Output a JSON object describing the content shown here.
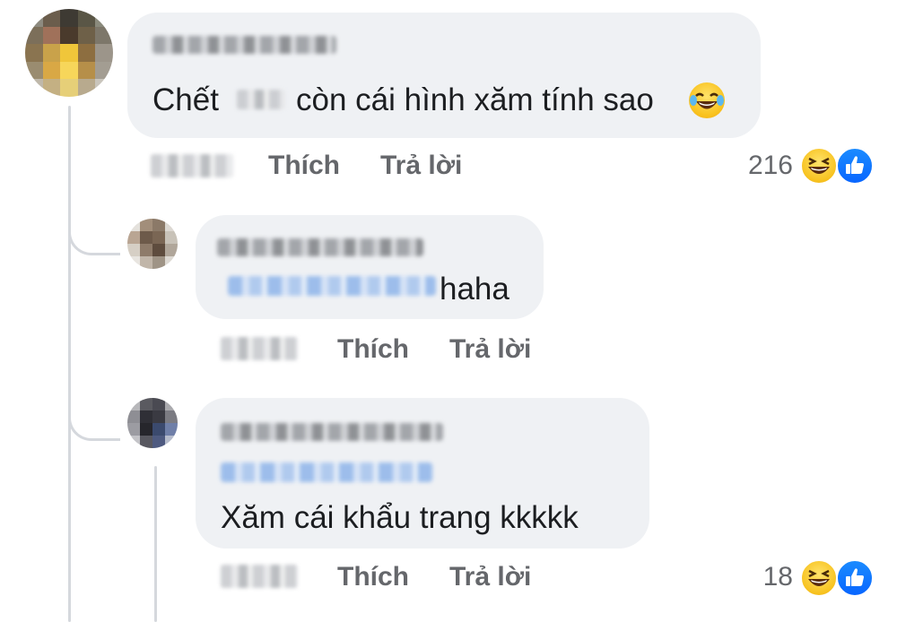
{
  "comments": [
    {
      "text_before": "Chết",
      "text_after": "còn cái hình xăm tính sao",
      "emoji": "face-with-tears-of-joy",
      "actions": {
        "like": "Thích",
        "reply": "Trả lời"
      },
      "reaction_count": "216",
      "reactions": [
        "haha",
        "like"
      ]
    },
    {
      "text": "haha",
      "actions": {
        "like": "Thích",
        "reply": "Trả lời"
      }
    },
    {
      "text": "Xăm cái khẩu trang kkkkk",
      "actions": {
        "like": "Thích",
        "reply": "Trả lời"
      },
      "reaction_count": "18",
      "reactions": [
        "haha",
        "like"
      ]
    }
  ],
  "colors": {
    "bubble": "#eff1f4",
    "action_text": "#65676b",
    "like_blue": "#0866ff",
    "mention": "#8fb5ea"
  }
}
